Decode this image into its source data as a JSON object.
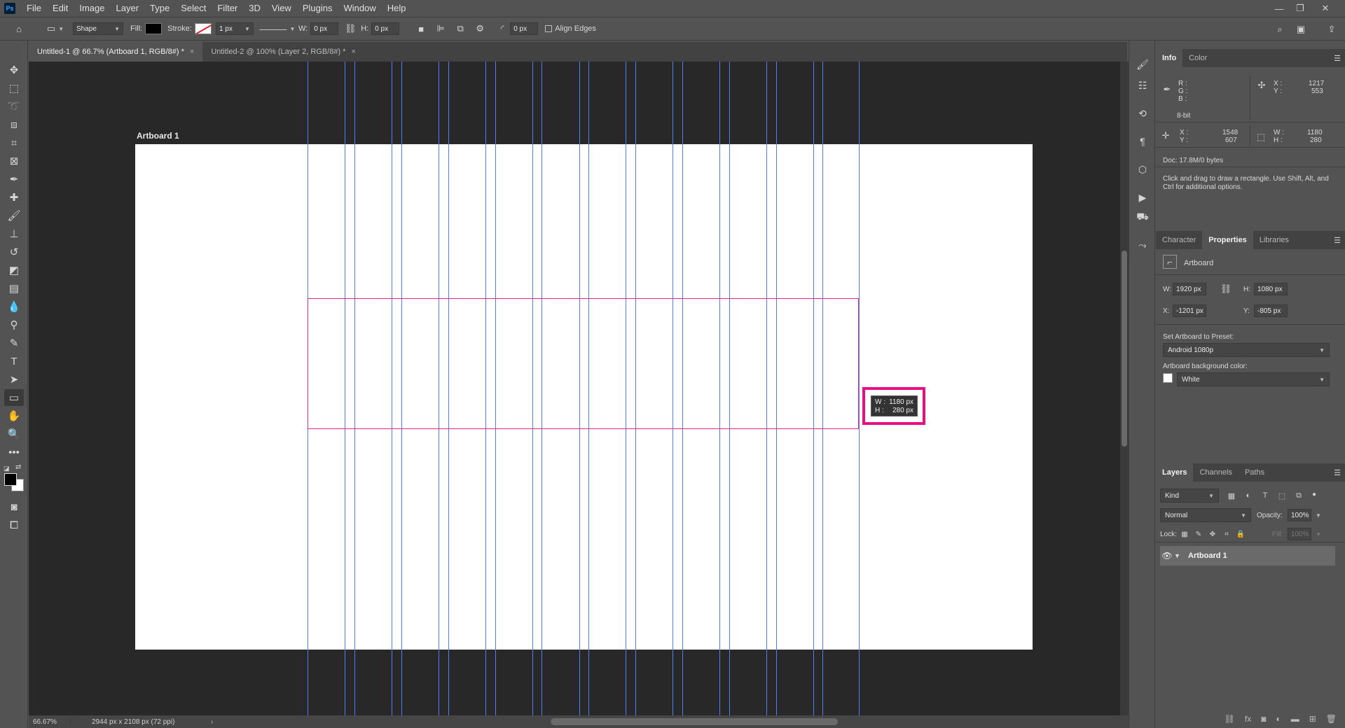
{
  "app": {
    "logo": "Ps"
  },
  "menu": [
    "File",
    "Edit",
    "Image",
    "Layer",
    "Type",
    "Select",
    "Filter",
    "3D",
    "View",
    "Plugins",
    "Window",
    "Help"
  ],
  "window_controls": {
    "minimize": "—",
    "restore": "❐",
    "close": "✕"
  },
  "options": {
    "tool_mode": "Shape",
    "fill_label": "Fill:",
    "fill_color": "#000000",
    "stroke_label": "Stroke:",
    "stroke_width": "1 px",
    "w_label": "W:",
    "w_value": "0 px",
    "h_label": "H:",
    "h_value": "0 px",
    "radius_value": "0 px",
    "align_edges": "Align Edges"
  },
  "tabs": [
    {
      "label": "Untitled-1 @ 66.7% (Artboard 1, RGB/8#) *",
      "close": "×"
    },
    {
      "label": "Untitled-2 @ 100% (Layer 2, RGB/8#) *",
      "close": "×"
    }
  ],
  "canvas": {
    "artboard_label": "Artboard 1",
    "tooltip": {
      "w_label": "W :",
      "w_value": "1180 px",
      "h_label": "H :",
      "h_value": "280 px"
    },
    "highlight_color": "#ec0f84",
    "guide_color": "#4f7df2"
  },
  "status": {
    "zoom": "66.67%",
    "doc_size": "2944 px x 2108 px (72 ppi)",
    "arrow": "›"
  },
  "info_panel": {
    "tabs": [
      "Info",
      "Color"
    ],
    "r": "R :",
    "g": "G :",
    "b": "B :",
    "x_label": "X :",
    "x_value": "1217",
    "y_label": "Y :",
    "y_value": "553",
    "bit": "8-bit",
    "x2_value": "1548",
    "y2_value": "607",
    "w_label": "W :",
    "w_value": "1180",
    "h_label": "H :",
    "h_value": "280",
    "doc": "Doc: 17.8M/0 bytes",
    "hint": "Click and drag to draw a rectangle.  Use Shift, Alt, and Ctrl for additional options."
  },
  "properties_panel": {
    "tabs": [
      "Character",
      "Properties",
      "Libraries"
    ],
    "type_label": "Artboard",
    "w_label": "W:",
    "w_value": "1920 px",
    "h_label": "H:",
    "h_value": "1080 px",
    "x_label": "X:",
    "x_value": "-1201 px",
    "y_label": "Y:",
    "y_value": "-805 px",
    "preset_label": "Set Artboard to Preset:",
    "preset_value": "Android 1080p",
    "bg_label": "Artboard background color:",
    "bg_value": "White"
  },
  "layers_panel": {
    "tabs": [
      "Layers",
      "Channels",
      "Paths"
    ],
    "filter": "Kind",
    "blend_mode": "Normal",
    "opacity_label": "Opacity:",
    "opacity_value": "100%",
    "lock_label": "Lock:",
    "fill_label": "Fill:",
    "fill_value": "100%",
    "layers": [
      {
        "name": "Artboard 1",
        "visible": true
      }
    ]
  }
}
